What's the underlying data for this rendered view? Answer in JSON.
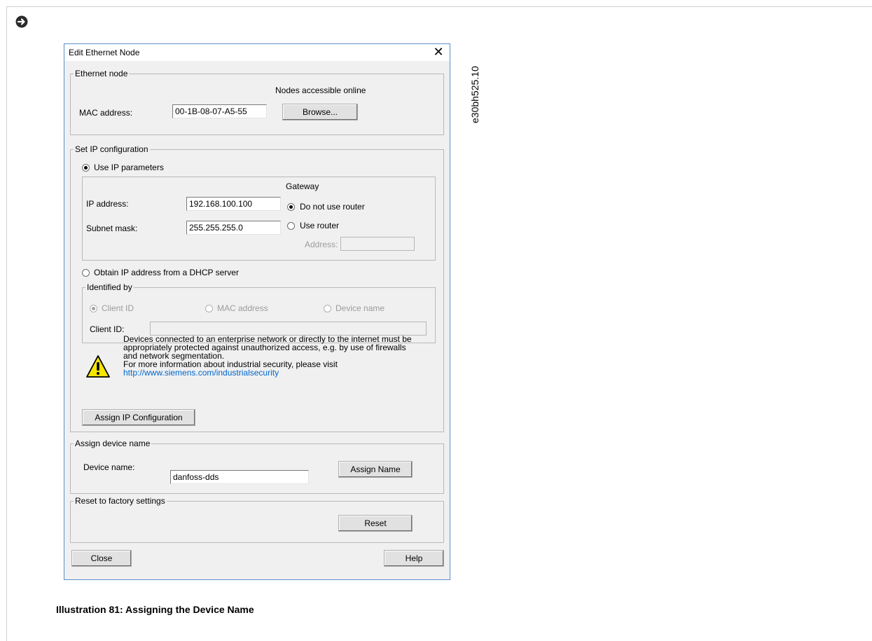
{
  "figure": {
    "code": "e30bh525.10",
    "caption": "Illustration 81: Assigning the Device Name",
    "arrow_icon": "circle-arrow-right-icon"
  },
  "dialog": {
    "title": "Edit Ethernet Node",
    "close_icon": "close-icon",
    "ethernet_node": {
      "legend": "Ethernet node",
      "nodes_online_label": "Nodes accessible online",
      "mac_label": "MAC address:",
      "mac_value": "00-1B-08-07-A5-55",
      "browse_button": "Browse..."
    },
    "ip_config": {
      "legend": "Set IP configuration",
      "use_ip_label": "Use IP parameters",
      "use_ip_selected": true,
      "ip_label": "IP address:",
      "ip_value": "192.168.100.100",
      "subnet_label": "Subnet mask:",
      "subnet_value": "255.255.255.0",
      "gateway_label": "Gateway",
      "no_router_label": "Do not use router",
      "use_router_label": "Use router",
      "address_label": "Address:",
      "address_value": "",
      "dhcp_label": "Obtain IP address from a DHCP server",
      "identified_by": {
        "legend": "Identified by",
        "client_id_option": "Client ID",
        "mac_option": "MAC address",
        "device_name_option": "Device name",
        "client_id_label": "Client ID:",
        "client_id_value": ""
      },
      "warning": {
        "icon": "warning-triangle-icon",
        "line1": "Devices connected to an enterprise network or directly to the internet must be",
        "line2": "appropriately protected against unauthorized access, e.g. by use of firewalls",
        "line3": "and network segmentation.",
        "line4": "For more information about industrial security, please visit",
        "link": "http://www.siemens.com/industrialsecurity"
      },
      "assign_ip_button": "Assign IP Configuration"
    },
    "device_name": {
      "legend": "Assign device name",
      "label": "Device name:",
      "value": "danfoss-dds",
      "assign_button": "Assign Name"
    },
    "reset": {
      "legend": "Reset to factory settings",
      "button": "Reset"
    },
    "close_button": "Close",
    "help_button": "Help"
  }
}
